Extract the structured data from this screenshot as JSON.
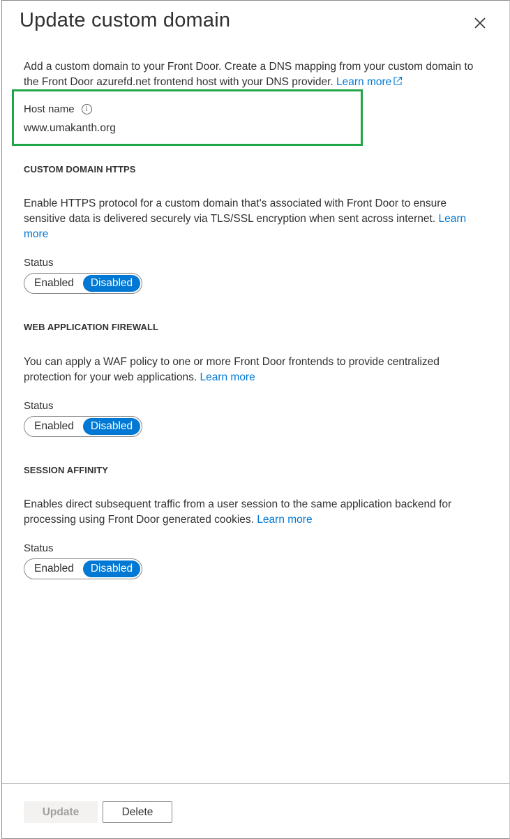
{
  "panel": {
    "title": "Update custom domain",
    "intro_text": "Add a custom domain to your Front Door. Create a DNS mapping from your custom domain to the Front Door azurefd.net frontend host with your DNS provider.",
    "intro_link": "Learn more"
  },
  "host": {
    "label": "Host name",
    "value": "www.umakanth.org"
  },
  "https": {
    "heading": "CUSTOM DOMAIN HTTPS",
    "description": "Enable HTTPS protocol for a custom domain that's associated with Front Door to ensure sensitive data is delivered securely via TLS/SSL encryption when sent across internet.",
    "link": "Learn more",
    "status_label": "Status",
    "option_enabled": "Enabled",
    "option_disabled": "Disabled",
    "selected": "Disabled"
  },
  "waf": {
    "heading": "WEB APPLICATION FIREWALL",
    "description": "You can apply a WAF policy to one or more Front Door frontends to provide centralized protection for your web applications.",
    "link": "Learn more",
    "status_label": "Status",
    "option_enabled": "Enabled",
    "option_disabled": "Disabled",
    "selected": "Disabled"
  },
  "affinity": {
    "heading": "SESSION AFFINITY",
    "description": "Enables direct subsequent traffic from a user session to the same application backend for processing using Front Door generated cookies.",
    "link": "Learn more",
    "status_label": "Status",
    "option_enabled": "Enabled",
    "option_disabled": "Disabled",
    "selected": "Disabled"
  },
  "footer": {
    "update_label": "Update",
    "delete_label": "Delete"
  },
  "colors": {
    "accent": "#0078d4",
    "highlight": "#22a547"
  }
}
